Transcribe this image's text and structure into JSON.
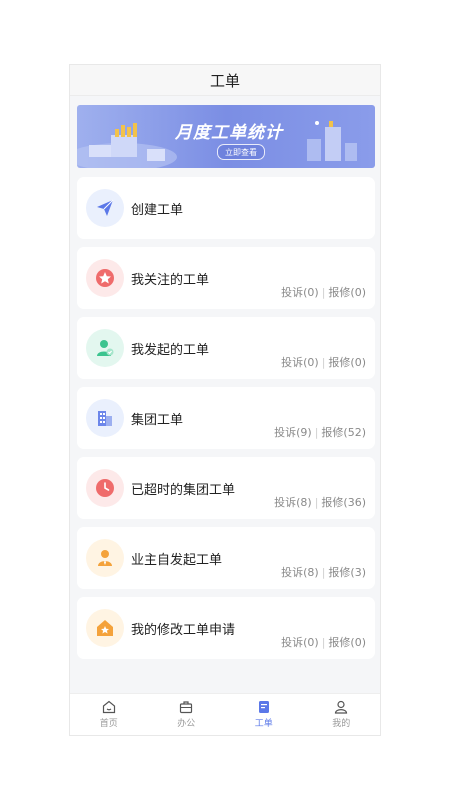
{
  "header": {
    "title": "工单"
  },
  "banner": {
    "title": "月度工单统计",
    "button": "立即查看"
  },
  "items": [
    {
      "label": "创建工单",
      "icon": "paper-plane-icon",
      "color": "#5b78e8",
      "bg": "#eaf0fd"
    },
    {
      "label": "我关注的工单",
      "icon": "star-icon",
      "color": "#ef6b6b",
      "bg": "#fde9e9",
      "complaint": "投诉(0)",
      "repair": "报修(0)"
    },
    {
      "label": "我发起的工单",
      "icon": "user-check-icon",
      "color": "#3cc48f",
      "bg": "#e3f7ef",
      "complaint": "投诉(0)",
      "repair": "报修(0)"
    },
    {
      "label": "集团工单",
      "icon": "buildings-icon",
      "color": "#6c86ea",
      "bg": "#eaf0fd",
      "complaint": "投诉(9)",
      "repair": "报修(52)"
    },
    {
      "label": "已超时的集团工单",
      "icon": "clock-icon",
      "color": "#ef6b6b",
      "bg": "#fde9e9",
      "complaint": "投诉(8)",
      "repair": "报修(36)"
    },
    {
      "label": "业主自发起工单",
      "icon": "owner-icon",
      "color": "#f4a23b",
      "bg": "#fff4e3",
      "complaint": "投诉(8)",
      "repair": "报修(3)"
    },
    {
      "label": "我的修改工单申请",
      "icon": "home-star-icon",
      "color": "#f4a23b",
      "bg": "#fff4e3",
      "complaint": "投诉(0)",
      "repair": "报修(0)"
    }
  ],
  "tabbar": [
    {
      "label": "首页",
      "icon": "home-icon"
    },
    {
      "label": "办公",
      "icon": "briefcase-icon"
    },
    {
      "label": "工单",
      "icon": "document-icon",
      "active": true
    },
    {
      "label": "我的",
      "icon": "user-icon"
    }
  ],
  "colors": {
    "accent": "#5b78e8",
    "muted": "#999999"
  }
}
